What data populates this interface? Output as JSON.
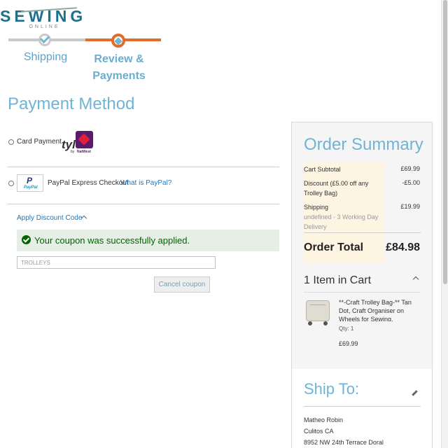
{
  "logo": {
    "main": "SEWING",
    "sub": "ONLINE"
  },
  "progress": {
    "steps": [
      {
        "label": "Shipping",
        "state": "complete"
      },
      {
        "label": "Review & Payments",
        "state": "active"
      }
    ]
  },
  "page_title": "Payment Method",
  "payment_options": {
    "card": {
      "label": "Card Payment",
      "provider_mark": "tyl",
      "provider_by": "by",
      "bank": "NatWest"
    },
    "paypal": {
      "logo_text": "PayPal",
      "label": "PayPal Express Checkout",
      "link": "What is PayPal?"
    }
  },
  "discount": {
    "toggle_label": "Apply Discount Code",
    "success_message": "Your coupon was successfully applied.",
    "coupon_value": "TROLLEYS",
    "cancel_label": "Cancel coupon"
  },
  "summary": {
    "title": "Order Summary",
    "rows": [
      {
        "label": "Cart Subtotal",
        "value": "£69.99"
      },
      {
        "label": "Discount (£5.00 off any Trolley Bag)",
        "value": "-£5.00"
      },
      {
        "label": "Shipping",
        "sub": "undefined - 3 Working Day Delivery",
        "value": "£19.99"
      }
    ],
    "order_total_label": "Order Total",
    "order_total_value": "£84.98",
    "items_title": "1 Item in Cart",
    "item": {
      "name": "**-Craft Trolley Bag-** Tan Dot, Craft Organiser on Wheels for Sewing,",
      "qty": "Qty: 1",
      "price": "£69.99"
    }
  },
  "ship_to": {
    "title": "Ship To:",
    "lines": [
      "Matheo Robin",
      "Culitos CA",
      "8952 NW 24th Terrace Doral"
    ]
  },
  "colors": {
    "accent": "#6fb4d6",
    "progress_active": "#e36b2c",
    "link": "#1979c3",
    "success": "#006400"
  },
  "icons": [
    "needle-icon",
    "check-icon",
    "chevron-up-icon",
    "success-check-icon",
    "pencil-icon"
  ]
}
